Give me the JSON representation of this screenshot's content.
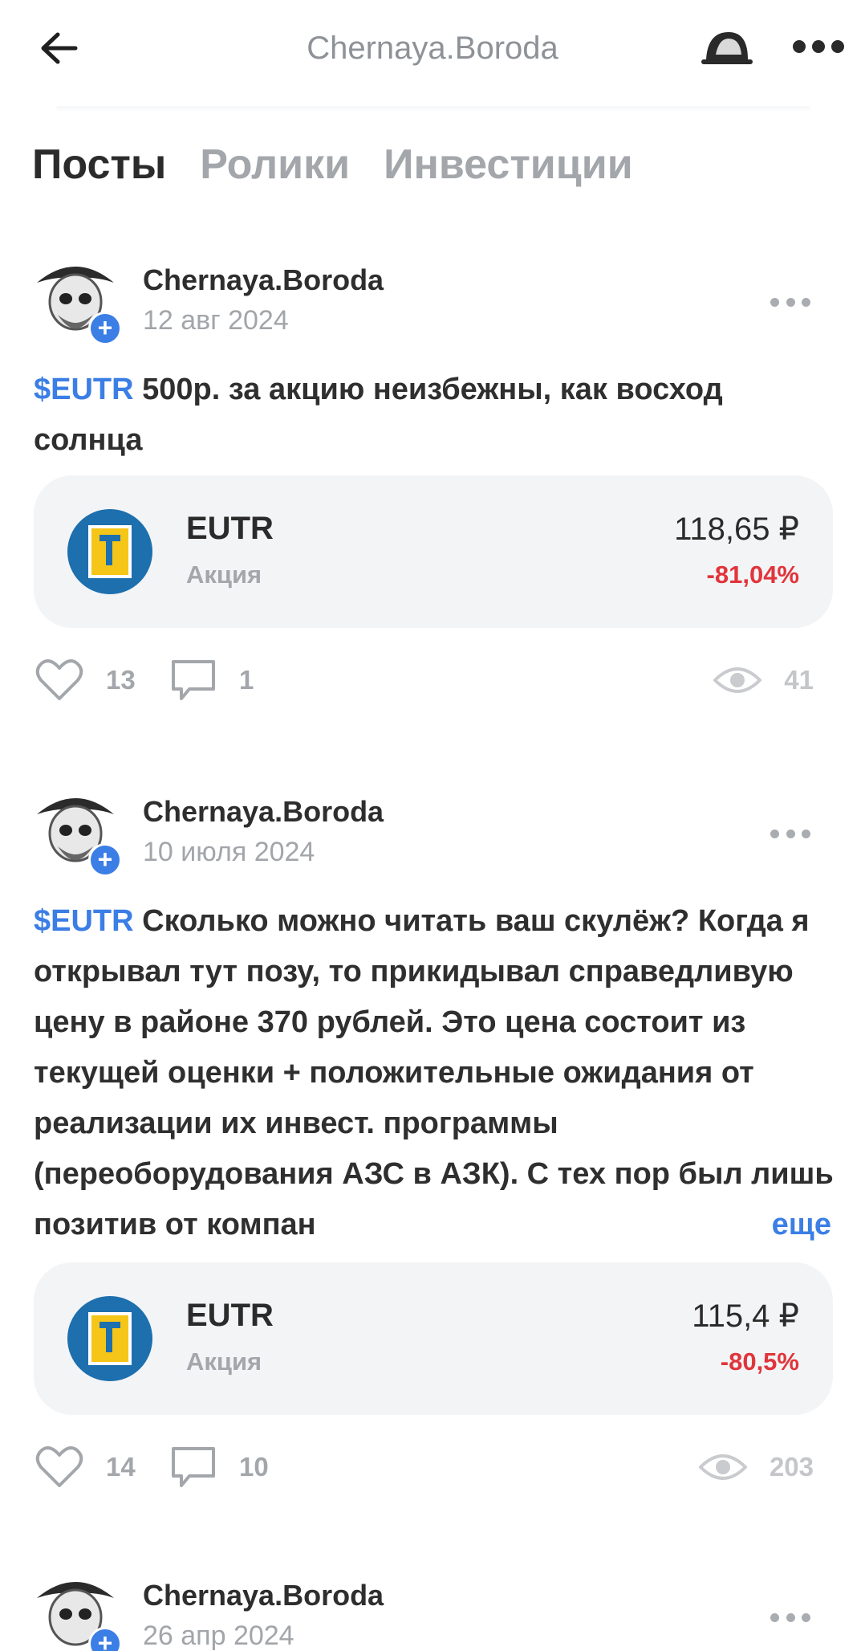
{
  "header": {
    "title": "Chernaya.Boroda"
  },
  "tabs": [
    {
      "label": "Посты",
      "active": true
    },
    {
      "label": "Ролики",
      "active": false
    },
    {
      "label": "Инвестиции",
      "active": false
    }
  ],
  "posts": [
    {
      "author": "Chernaya.Boroda",
      "date": "12 авг 2024",
      "ticker": "$EUTR",
      "text": " 500р. за акцию неизбежны, как восход солнца",
      "asset": {
        "name": "EUTR",
        "type": "Акция",
        "price": "118,65 ₽",
        "change": "-81,04%"
      },
      "likes": "13",
      "comments": "1",
      "views": "41"
    },
    {
      "author": "Chernaya.Boroda",
      "date": "10 июля 2024",
      "ticker": "$EUTR",
      "text": " Сколько можно читать ваш скулёж? Когда я открывал тут позу, то прикидывал справедливую цену в районе 370 рублей. Это цена состоит из текущей оценки + положительные ожидания от реализации их инвест. программы (переоборудования АЗС в АЗК). С тех пор был лишь позитив от компан",
      "more_label": "еще",
      "asset": {
        "name": "EUTR",
        "type": "Акция",
        "price": "115,4 ₽",
        "change": "-80,5%"
      },
      "likes": "14",
      "comments": "10",
      "views": "203"
    },
    {
      "author": "Chernaya.Boroda",
      "date": "26 апр 2024"
    }
  ],
  "colors": {
    "accent": "#3b7ee5",
    "negative": "#e0353b",
    "muted": "#a3a6aa"
  }
}
